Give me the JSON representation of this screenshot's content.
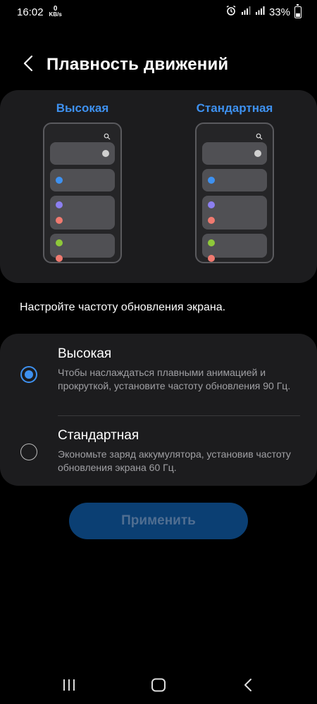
{
  "status_bar": {
    "time": "16:02",
    "net_speed_value": "0",
    "net_speed_unit": "KB/s",
    "battery": "33%",
    "icons": [
      "alarm-icon",
      "signal-icon",
      "signal-icon",
      "battery-icon"
    ]
  },
  "header": {
    "back_icon": "chevron-left-icon",
    "title": "Плавность движений"
  },
  "preview": {
    "left_label": "Высокая",
    "right_label": "Стандартная"
  },
  "description": "Настройте частоту обновления экрана.",
  "options": [
    {
      "title": "Высокая",
      "subtitle": "Чтобы наслаждаться плавными анимацией и прокруткой, установите частоту обновления 90 Гц.",
      "selected": true
    },
    {
      "title": "Стандартная",
      "subtitle": "Экономьте заряд аккумулятора, установив частоту обновления экрана 60 Гц.",
      "selected": false
    }
  ],
  "apply_button": {
    "label": "Применить",
    "enabled": false
  },
  "nav_bar": {
    "icons": [
      "recents-icon",
      "home-icon",
      "back-icon"
    ]
  },
  "colors": {
    "accent": "#3e91f0",
    "card": "#1c1c1e",
    "button_disabled_bg": "#0b3f73",
    "button_disabled_text": "#506e91",
    "mini_dot_white": "#d0d0d0",
    "mini_dot_blue": "#3e91f0",
    "mini_dot_purple": "#8c7ff0",
    "mini_dot_red": "#f07a70",
    "mini_dot_green": "#8ec83a"
  }
}
